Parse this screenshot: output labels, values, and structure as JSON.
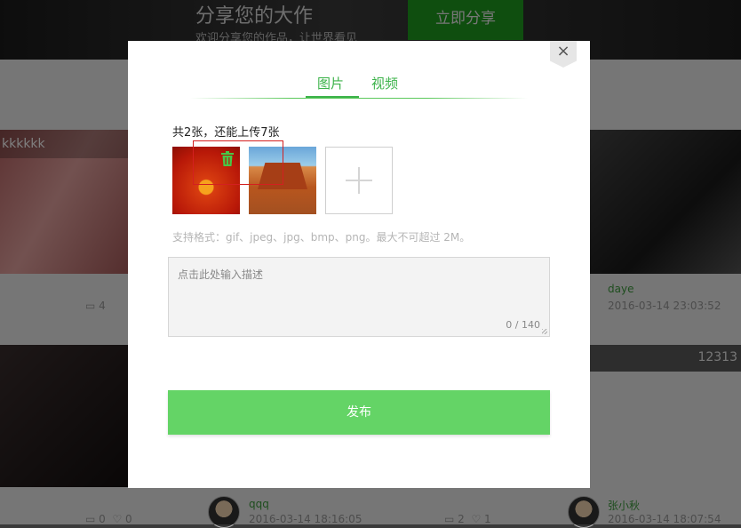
{
  "background": {
    "header_title": "分享您的大作",
    "header_subtitle": "欢迎分享您的作品，让世界看见",
    "share_button": "立即分享",
    "card1_caption": "kkkkkk",
    "card1_comments": "4",
    "right_user1": "daye",
    "right_time1": "2016-03-14 23:03:52",
    "right_badge": "12313",
    "bottom_left_comments": "0",
    "bottom_left_likes": "0",
    "mid_user": "qqq",
    "mid_time": "2016-03-14 18:16:05",
    "mid_comments": "2",
    "mid_likes": "1",
    "right_user2": "张小秋",
    "right_time2": "2016-03-14 18:07:54"
  },
  "modal": {
    "close_icon": "×",
    "tabs": [
      {
        "label": "图片",
        "active": true
      },
      {
        "label": "视频",
        "active": false
      }
    ],
    "upload_count_text": "共2张，还能上传7张",
    "format_hint": "支持格式：gif、jpeg、jpg、bmp、png。最大不可超过 2M。",
    "description_placeholder": "点击此处输入描述",
    "char_counter": "0 / 140",
    "publish_button": "发布"
  },
  "colors": {
    "accent": "#3cb34a",
    "publish_bg": "#64d466",
    "selection_border": "#d32020"
  }
}
